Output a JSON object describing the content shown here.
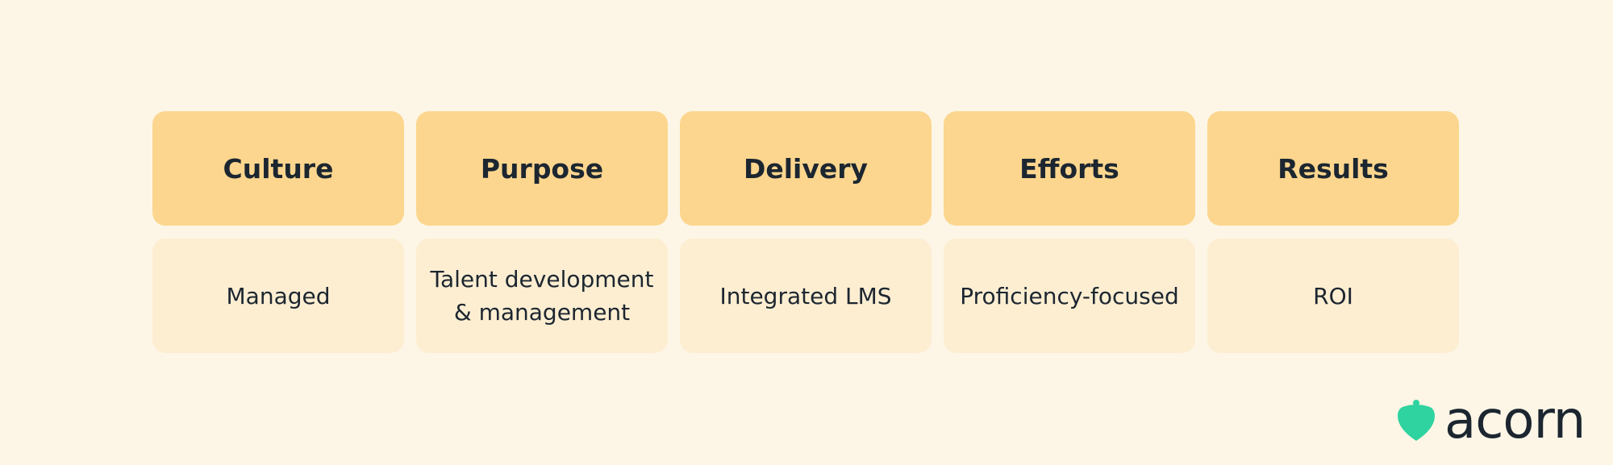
{
  "columns": [
    {
      "header": "Culture",
      "value": "Managed"
    },
    {
      "header": "Purpose",
      "value": "Talent development\n& management"
    },
    {
      "header": "Delivery",
      "value": "Integrated LMS"
    },
    {
      "header": "Efforts",
      "value": "Proficiency-focused"
    },
    {
      "header": "Results",
      "value": "ROI"
    }
  ],
  "logo": {
    "text": "acorn",
    "icon": "acorn-icon",
    "color": "#2ed3a0"
  },
  "colors": {
    "header_bg": "#fcd68e",
    "body_bg": "#fdeed2",
    "page_bg": "#fdf6e6"
  }
}
